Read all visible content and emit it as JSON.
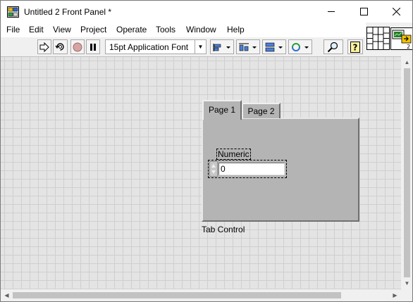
{
  "window": {
    "title": "Untitled 2 Front Panel *",
    "controls": [
      "minimize-icon",
      "maximize-icon",
      "close-icon"
    ]
  },
  "menu": [
    "File",
    "Edit",
    "View",
    "Project",
    "Operate",
    "Tools",
    "Window",
    "Help"
  ],
  "toolbar": {
    "font": "15pt Application Font",
    "connector_number": "2"
  },
  "panel": {
    "tab_control": {
      "caption": "Tab Control",
      "tabs": [
        "Page 1",
        "Page 2"
      ],
      "selected": "Page 1"
    },
    "numeric": {
      "label": "Numeric",
      "value": "0"
    }
  }
}
